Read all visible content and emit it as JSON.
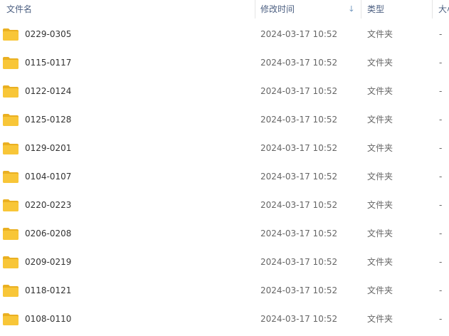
{
  "columns": {
    "name": "文件名",
    "modified": "修改时间",
    "sort_indicator": "down-arrow-icon",
    "type": "类型",
    "size": "大小"
  },
  "colors": {
    "folder": "#f8c638",
    "folder_dark": "#eab022",
    "header_text": "#4d6082",
    "sort_arrow": "#3a6ea5"
  },
  "rows": [
    {
      "icon": "folder-icon",
      "name": "0229-0305",
      "modified": "2024-03-17 10:52",
      "type": "文件夹",
      "size": "-"
    },
    {
      "icon": "folder-icon",
      "name": "0115-0117",
      "modified": "2024-03-17 10:52",
      "type": "文件夹",
      "size": "-"
    },
    {
      "icon": "folder-icon",
      "name": "0122-0124",
      "modified": "2024-03-17 10:52",
      "type": "文件夹",
      "size": "-"
    },
    {
      "icon": "folder-icon",
      "name": "0125-0128",
      "modified": "2024-03-17 10:52",
      "type": "文件夹",
      "size": "-"
    },
    {
      "icon": "folder-icon",
      "name": "0129-0201",
      "modified": "2024-03-17 10:52",
      "type": "文件夹",
      "size": "-"
    },
    {
      "icon": "folder-icon",
      "name": "0104-0107",
      "modified": "2024-03-17 10:52",
      "type": "文件夹",
      "size": "-"
    },
    {
      "icon": "folder-icon",
      "name": "0220-0223",
      "modified": "2024-03-17 10:52",
      "type": "文件夹",
      "size": "-"
    },
    {
      "icon": "folder-icon",
      "name": "0206-0208",
      "modified": "2024-03-17 10:52",
      "type": "文件夹",
      "size": "-"
    },
    {
      "icon": "folder-icon",
      "name": "0209-0219",
      "modified": "2024-03-17 10:52",
      "type": "文件夹",
      "size": "-"
    },
    {
      "icon": "folder-icon",
      "name": "0118-0121",
      "modified": "2024-03-17 10:52",
      "type": "文件夹",
      "size": "-"
    },
    {
      "icon": "folder-icon",
      "name": "0108-0110",
      "modified": "2024-03-17 10:52",
      "type": "文件夹",
      "size": "-"
    }
  ]
}
